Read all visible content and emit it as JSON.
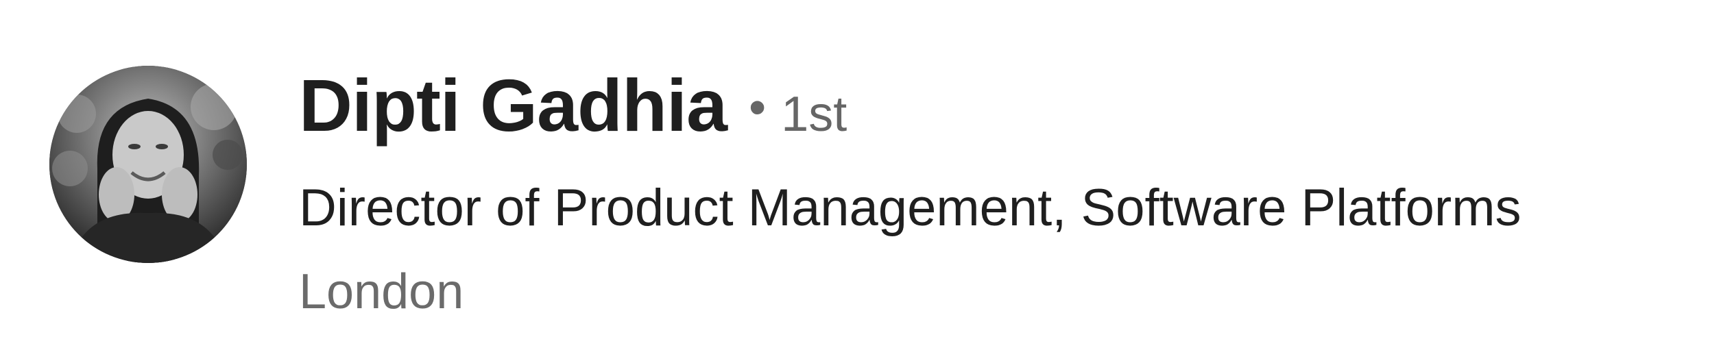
{
  "profile": {
    "avatar_icon": "profile-photo-icon",
    "name": "Dipti Gadhia",
    "separator": "•",
    "connection_degree": "1st",
    "headline": "Director of Product Management, Software Platforms",
    "location": "London"
  },
  "colors": {
    "text_primary": "#1f1f1f",
    "text_secondary": "#666666",
    "background": "#ffffff"
  }
}
